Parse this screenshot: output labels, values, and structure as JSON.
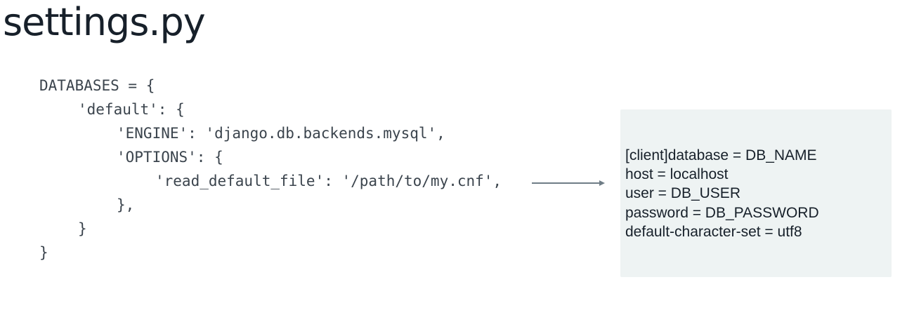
{
  "slide": {
    "title": "settings.py"
  },
  "code": {
    "lines": [
      "DATABASES = {",
      "'default': {",
      "'ENGINE': 'django.db.backends.mysql',",
      "'OPTIONS': {",
      "'read_default_file': '/path/to/my.cnf',",
      "},",
      "}",
      "}"
    ]
  },
  "config_file": {
    "lines": [
      "[client]database = DB_NAME",
      "host = localhost",
      "user = DB_USER",
      "password = DB_PASSWORD",
      "default-character-set = utf8"
    ]
  },
  "icons": {
    "connector": "right-arrow-icon"
  },
  "colors": {
    "title": "#17202a",
    "code_text": "#3b444d",
    "config_background": "#eef3f3",
    "arrow": "#6f7d86"
  }
}
